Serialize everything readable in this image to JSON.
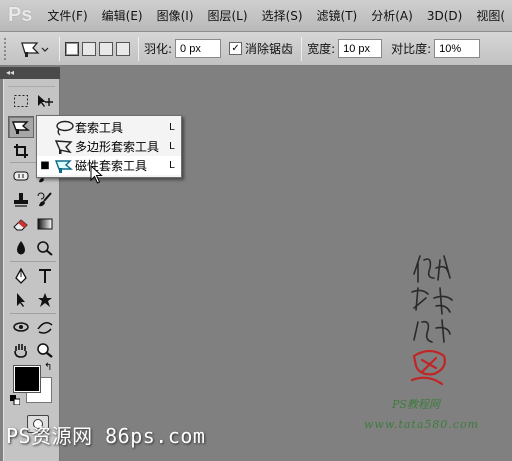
{
  "app": {
    "logo": "Ps"
  },
  "menu": [
    "文件(F)",
    "编辑(E)",
    "图像(I)",
    "图层(L)",
    "选择(S)",
    "滤镜(T)",
    "分析(A)",
    "3D(D)",
    "视图("
  ],
  "options": {
    "feather_label": "羽化:",
    "feather_value": "0 px",
    "antialias_label": "消除锯齿",
    "antialias_checked": true,
    "width_label": "宽度:",
    "width_value": "10 px",
    "contrast_label": "对比度:",
    "contrast_value": "10%"
  },
  "toolbar": {
    "collapse_glyph": "◂◂",
    "tools": [
      "rectangular-marquee",
      "move",
      "lasso",
      "crop",
      "quick-selection",
      "slice",
      "spot-healing",
      "brush",
      "clone-stamp",
      "history-brush",
      "eraser",
      "gradient",
      "blur",
      "dodge",
      "pen",
      "type",
      "path-selection",
      "custom-shape",
      "3d-rotate",
      "3d-orbit",
      "hand",
      "zoom"
    ],
    "foreground_color": "#000000",
    "background_color": "#ffffff"
  },
  "flyout": {
    "items": [
      {
        "label": "套索工具",
        "shortcut": "L",
        "icon": "lasso-icon",
        "active": false
      },
      {
        "label": "多边形套索工具",
        "shortcut": "L",
        "icon": "polygonal-lasso-icon",
        "active": false
      },
      {
        "label": "磁性套索工具",
        "shortcut": "L",
        "icon": "magnetic-lasso-icon",
        "active": true
      }
    ],
    "active_bullet": "■"
  },
  "watermarks": {
    "bottom_left": "PS资源网 86ps.com",
    "right_line1": "PS教程网",
    "right_line2": "www.tata580.com",
    "calligraphy_text": "他处我帮你"
  }
}
